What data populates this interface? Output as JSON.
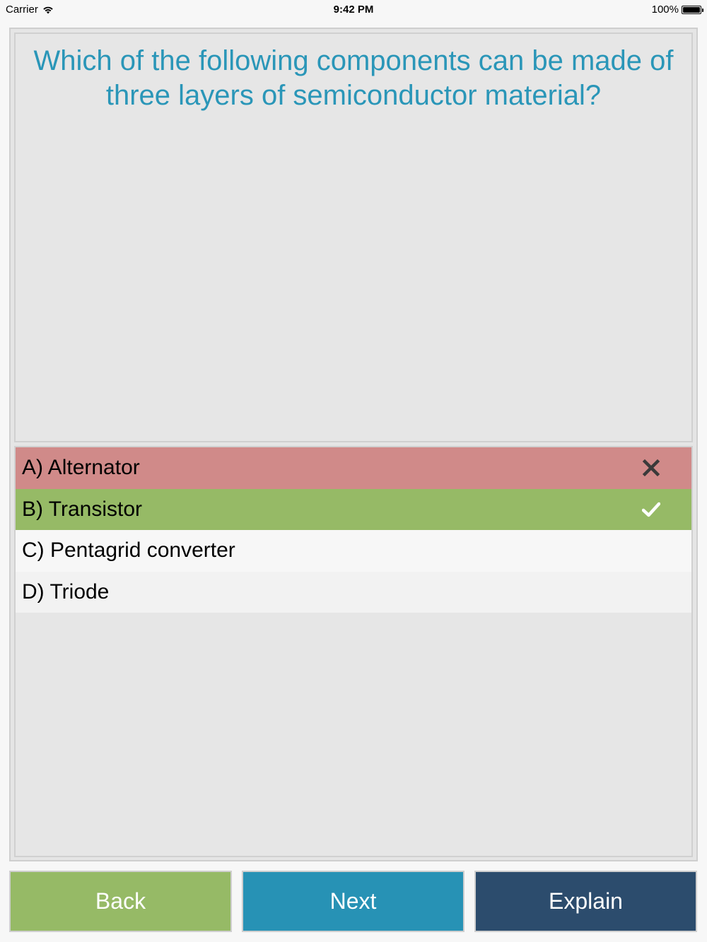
{
  "status_bar": {
    "carrier": "Carrier",
    "time": "9:42 PM",
    "battery": "100%",
    "icons": [
      "wifi-icon",
      "battery-icon"
    ]
  },
  "question": {
    "text": "Which of the following components can be made of three layers of semiconductor material?",
    "color": "#2a96b8"
  },
  "answers": [
    {
      "label": "A) Alternator",
      "state": "wrong",
      "icon": "x-mark-icon",
      "color": "#d08a89"
    },
    {
      "label": "B) Transistor",
      "state": "correct",
      "icon": "checkmark-icon",
      "color": "#96ba66"
    },
    {
      "label": "C) Pentagrid converter",
      "state": "none"
    },
    {
      "label": "D) Triode",
      "state": "none"
    }
  ],
  "buttons": {
    "back": {
      "label": "Back",
      "color": "#96ba66"
    },
    "next": {
      "label": "Next",
      "color": "#2792b5"
    },
    "explain": {
      "label": "Explain",
      "color": "#2c4c6d"
    }
  }
}
